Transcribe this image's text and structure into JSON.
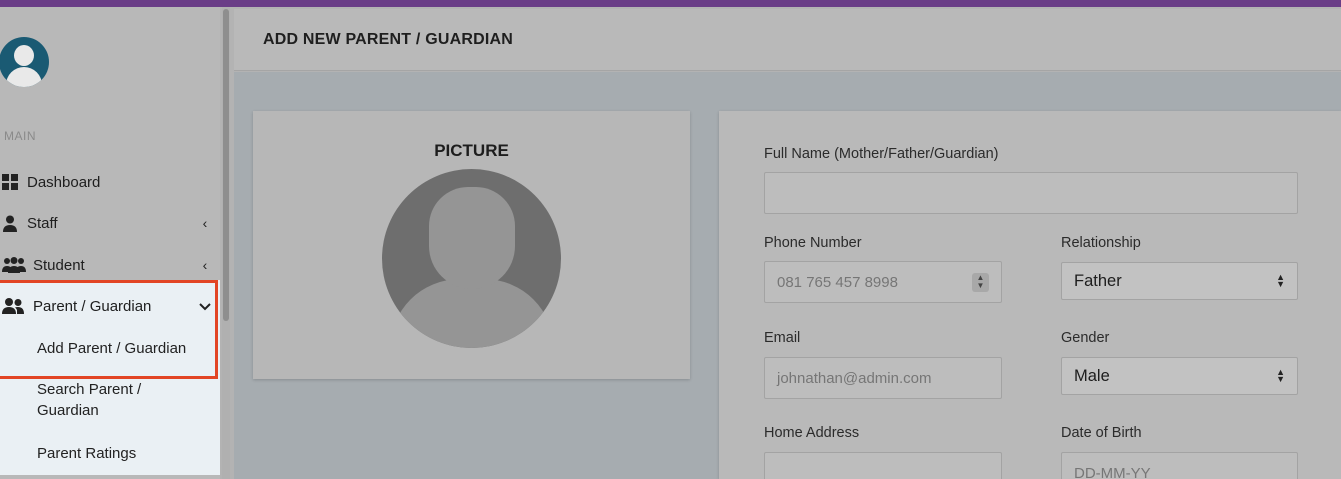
{
  "sidebar": {
    "section_label": "MAIN",
    "items": [
      {
        "label": "Dashboard",
        "icon": "dashboard-grid-icon"
      },
      {
        "label": "Staff",
        "icon": "staff-user-icon",
        "chevron": "‹"
      },
      {
        "label": "Student",
        "icon": "students-group-icon",
        "chevron": "‹"
      },
      {
        "label": "Parent / Guardian",
        "icon": "parents-group-icon",
        "chevron": "⌄"
      }
    ],
    "submenu": [
      {
        "label": "Add Parent / Guardian"
      },
      {
        "label": "Search Parent / Guardian"
      },
      {
        "label": "Parent Ratings"
      }
    ]
  },
  "header": {
    "title": "ADD NEW PARENT / GUARDIAN"
  },
  "picture": {
    "title": "PICTURE"
  },
  "form": {
    "full_name": {
      "label": "Full Name (Mother/Father/Guardian)",
      "value": ""
    },
    "phone": {
      "label": "Phone Number",
      "placeholder": "081 765 457 8998"
    },
    "relationship": {
      "label": "Relationship",
      "value": "Father"
    },
    "email": {
      "label": "Email",
      "placeholder": "johnathan@admin.com"
    },
    "gender": {
      "label": "Gender",
      "value": "Male"
    },
    "address": {
      "label": "Home Address",
      "value": ""
    },
    "dob": {
      "label": "Date of Birth",
      "placeholder": "DD-MM-YY"
    }
  },
  "colors": {
    "topbar": "#6a3d87",
    "highlight": "#e24524",
    "avatar": "#1a5a73"
  }
}
